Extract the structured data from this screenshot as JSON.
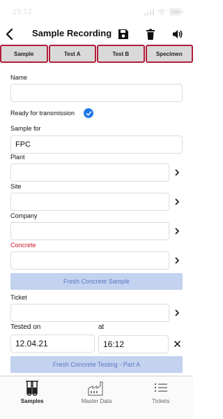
{
  "status_bar": {
    "time": "15:12"
  },
  "header": {
    "title": "Sample Recording"
  },
  "tabs": [
    {
      "label": "Sample"
    },
    {
      "label": "Test A"
    },
    {
      "label": "Test B"
    },
    {
      "label": "Specimen"
    }
  ],
  "form": {
    "name_label": "Name",
    "name_value": "",
    "ready_label": "Ready for transmission",
    "sample_for_label": "Sample for",
    "sample_for_value": "FPC",
    "plant_label": "Plant",
    "plant_value": "",
    "site_label": "Site",
    "site_value": "",
    "company_label": "Company",
    "company_value": "",
    "concrete_label": "Concrete",
    "concrete_value": "",
    "fresh_sample_button": "Fresh Concrete Sample",
    "ticket_label": "Ticket",
    "ticket_value": "",
    "tested_on_label": "Tested on",
    "tested_on_value": "12.04.21",
    "at_label": "at",
    "at_value": "16:12",
    "fresh_testing_button": "Fresh Concrete Testing - Part A"
  },
  "bottom_nav": [
    {
      "label": "Samples",
      "icon": "test-tubes-icon",
      "active": true
    },
    {
      "label": "Master Data",
      "icon": "factory-icon",
      "active": false
    },
    {
      "label": "Tickets",
      "icon": "list-icon",
      "active": false
    }
  ],
  "colors": {
    "tab_border": "#b11e3a",
    "accent_blue": "#1f7ae6",
    "button_bg": "#c3d2ef",
    "button_text": "#5b79c4",
    "required_label": "#d0142c"
  }
}
